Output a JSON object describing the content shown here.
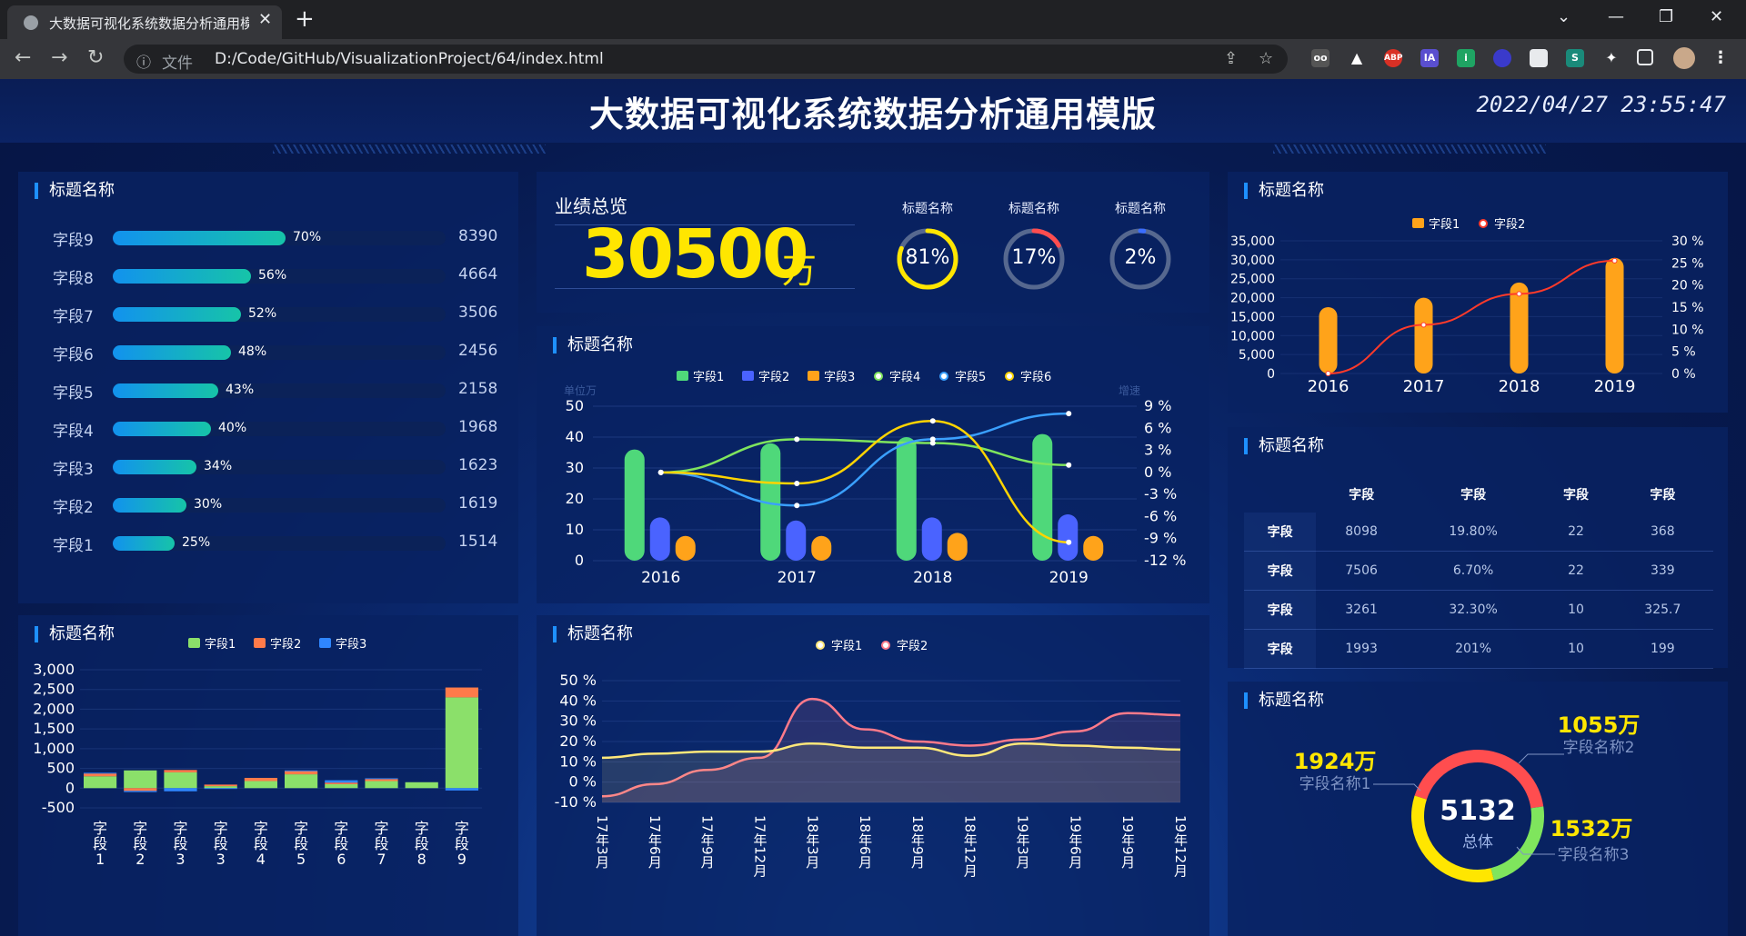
{
  "browser": {
    "tab_title": "大数据可视化系统数据分析通用模",
    "url_label": "文件",
    "url": "D:/Code/GitHub/VisualizationProject/64/index.html"
  },
  "header": {
    "title": "大数据可视化系统数据分析通用模版",
    "datetime": "2022/04/27 23:55:47"
  },
  "panel_bars": {
    "title": "标题名称",
    "items": [
      {
        "label": "字段9",
        "pct": "70%",
        "value": "8390",
        "ratio": 0.7
      },
      {
        "label": "字段8",
        "pct": "56%",
        "value": "4664",
        "ratio": 0.56
      },
      {
        "label": "字段7",
        "pct": "52%",
        "value": "3506",
        "ratio": 0.52
      },
      {
        "label": "字段6",
        "pct": "48%",
        "value": "2456",
        "ratio": 0.48
      },
      {
        "label": "字段5",
        "pct": "43%",
        "value": "2158",
        "ratio": 0.43
      },
      {
        "label": "字段4",
        "pct": "40%",
        "value": "1968",
        "ratio": 0.4
      },
      {
        "label": "字段3",
        "pct": "34%",
        "value": "1623",
        "ratio": 0.34
      },
      {
        "label": "字段2",
        "pct": "30%",
        "value": "1619",
        "ratio": 0.3
      },
      {
        "label": "字段1",
        "pct": "25%",
        "value": "1514",
        "ratio": 0.25
      }
    ]
  },
  "kpi": {
    "label": "业绩总览",
    "value": "30500",
    "unit": "万",
    "gauges": [
      {
        "title": "标题名称",
        "text": "81%",
        "ratio": 0.81,
        "color": "#ffe600"
      },
      {
        "title": "标题名称",
        "text": "17%",
        "ratio": 0.17,
        "color": "#ff4d4f"
      },
      {
        "title": "标题名称",
        "text": "2%",
        "ratio": 0.02,
        "color": "#3a6dff"
      }
    ]
  },
  "chart_mid": {
    "title": "标题名称",
    "unit_left": "单位万",
    "unit_right": "增速",
    "legend": [
      "字段1",
      "字段2",
      "字段3",
      "字段4",
      "字段5",
      "字段6"
    ],
    "x_ticks": [
      "2016",
      "2017",
      "2018",
      "2019"
    ],
    "y_left_ticks": [
      "50",
      "40",
      "30",
      "20",
      "10",
      "0"
    ],
    "y_right_ticks": [
      "9 %",
      "6 %",
      "3 %",
      "0 %",
      "-3 %",
      "-6 %",
      "-9 %",
      "-12 %"
    ]
  },
  "chart_tr": {
    "title": "标题名称",
    "legend": [
      "字段1",
      "字段2"
    ],
    "x_ticks": [
      "2016",
      "2017",
      "2018",
      "2019"
    ],
    "y_left_ticks": [
      "35,000",
      "30,000",
      "25,000",
      "20,000",
      "15,000",
      "10,000",
      "5,000",
      "0"
    ],
    "y_right_ticks": [
      "30 %",
      "25 %",
      "20 %",
      "15 %",
      "10 %",
      "5 %",
      "0 %"
    ]
  },
  "table": {
    "title": "标题名称",
    "headers": [
      "",
      "字段",
      "字段",
      "字段",
      "字段"
    ],
    "rows": [
      [
        "字段",
        "8098",
        "19.80%",
        "22",
        "368"
      ],
      [
        "字段",
        "7506",
        "6.70%",
        "22",
        "339"
      ],
      [
        "字段",
        "3261",
        "32.30%",
        "10",
        "325.7"
      ],
      [
        "字段",
        "1993",
        "201%",
        "10",
        "199"
      ]
    ]
  },
  "chart_stack": {
    "title": "标题名称",
    "legend": [
      "字段1",
      "字段2",
      "字段3"
    ],
    "y_ticks": [
      "3,000",
      "2,500",
      "2,000",
      "1,500",
      "1,000",
      "500",
      "0",
      "-500"
    ],
    "categories": [
      "字段1",
      "字段2",
      "字段3",
      "字段3",
      "字段4",
      "字段5",
      "字段6",
      "字段7",
      "字段8",
      "字段9"
    ],
    "category_labels": [
      "字\n段\n1",
      "字\n段\n2",
      "字\n段\n3",
      "字\n段\n3",
      "字\n段\n4",
      "字\n段\n5",
      "字\n段\n6",
      "字\n段\n7",
      "字\n段\n8",
      "字\n段\n9"
    ]
  },
  "chart_line": {
    "title": "标题名称",
    "legend": [
      "字段1",
      "字段2"
    ],
    "y_ticks": [
      "50 %",
      "40 %",
      "30 %",
      "20 %",
      "10 %",
      "0 %",
      "-10 %"
    ],
    "x_ticks": [
      "17年3月",
      "17年6月",
      "17年9月",
      "17年12月",
      "18年3月",
      "18年6月",
      "18年9月",
      "18年12月",
      "19年3月",
      "19年6月",
      "19年9月",
      "19年12月"
    ]
  },
  "chart_donut": {
    "title": "标题名称",
    "center_value": "5132",
    "center_label": "总体",
    "items": [
      {
        "value": "1924万",
        "label": "字段名称1",
        "color": "#ff4d4f"
      },
      {
        "value": "1055万",
        "label": "字段名称2",
        "color": "#7fe55d"
      },
      {
        "value": "1532万",
        "label": "字段名称3",
        "color": "#ffe600"
      }
    ]
  },
  "chart_data": [
    {
      "type": "bar",
      "title": "",
      "categories": [
        "字段9",
        "字段8",
        "字段7",
        "字段6",
        "字段5",
        "字段4",
        "字段3",
        "字段2",
        "字段1"
      ],
      "values": [
        8390,
        4664,
        3506,
        2456,
        2158,
        1968,
        1623,
        1619,
        1514
      ],
      "percent": [
        70,
        56,
        52,
        48,
        43,
        40,
        34,
        30,
        25
      ]
    },
    {
      "type": "bar",
      "categories": [
        "2016",
        "2017",
        "2018",
        "2019"
      ],
      "ylabel": "单位万",
      "y2label": "增速",
      "ylim": [
        0,
        50
      ],
      "y2lim": [
        -12,
        9
      ],
      "series": [
        {
          "name": "字段1",
          "kind": "bar",
          "values": [
            36,
            38,
            40,
            41
          ],
          "color": "#4fd87a"
        },
        {
          "name": "字段2",
          "kind": "bar",
          "values": [
            14,
            13,
            14,
            15
          ],
          "color": "#4a63ff"
        },
        {
          "name": "字段3",
          "kind": "bar",
          "values": [
            8,
            8,
            9,
            8
          ],
          "color": "#ffa31a"
        },
        {
          "name": "字段4",
          "kind": "line",
          "axis": "right",
          "values": [
            0,
            4.5,
            4,
            1
          ],
          "color": "#7fe55d"
        },
        {
          "name": "字段5",
          "kind": "line",
          "axis": "right",
          "values": [
            0,
            -4.5,
            4.5,
            8
          ],
          "color": "#3aa0ff"
        },
        {
          "name": "字段6",
          "kind": "line",
          "axis": "right",
          "values": [
            0,
            -1.5,
            7,
            -9.5
          ],
          "color": "#ffd400"
        }
      ]
    },
    {
      "type": "bar",
      "categories": [
        "2016",
        "2017",
        "2018",
        "2019"
      ],
      "ylim": [
        0,
        35000
      ],
      "y2lim": [
        0,
        30
      ],
      "series": [
        {
          "name": "字段1",
          "kind": "bar",
          "values": [
            17500,
            20000,
            24000,
            30500
          ],
          "color": "#ffa31a"
        },
        {
          "name": "字段2",
          "kind": "line",
          "axis": "right",
          "values": [
            0,
            11,
            18,
            25.5
          ],
          "color": "#ff3a2a"
        }
      ]
    },
    {
      "type": "bar",
      "stacked": true,
      "categories": [
        "字段1",
        "字段2",
        "字段3",
        "字段3",
        "字段4",
        "字段5",
        "字段6",
        "字段7",
        "字段8",
        "字段9"
      ],
      "ylim": [
        -500,
        3000
      ],
      "series": [
        {
          "name": "字段1",
          "values": [
            300,
            450,
            400,
            50,
            180,
            350,
            100,
            180,
            150,
            2300
          ],
          "color": "#8be06a"
        },
        {
          "name": "字段2",
          "values": [
            70,
            -70,
            60,
            40,
            80,
            80,
            40,
            50,
            0,
            250
          ],
          "color": "#ff7b4a"
        },
        {
          "name": "字段3",
          "values": [
            20,
            -30,
            -80,
            -20,
            0,
            20,
            60,
            20,
            0,
            -60
          ],
          "color": "#2f86ff"
        }
      ]
    },
    {
      "type": "area",
      "x": [
        "17年3月",
        "17年6月",
        "17年9月",
        "17年12月",
        "18年3月",
        "18年6月",
        "18年9月",
        "18年12月",
        "19年3月",
        "19年6月",
        "19年9月",
        "19年12月"
      ],
      "ylim": [
        -10,
        50
      ],
      "series": [
        {
          "name": "字段1",
          "values": [
            12,
            14,
            15,
            15,
            19,
            17,
            17,
            13,
            19,
            18,
            17,
            16
          ],
          "color": "#ffe87a"
        },
        {
          "name": "字段2",
          "values": [
            -7,
            -1,
            6,
            12,
            41,
            26,
            20,
            18,
            21,
            25,
            34,
            33
          ],
          "color": "#ff7a8a"
        }
      ]
    },
    {
      "type": "pie",
      "title": "",
      "categories": [
        "字段名称1",
        "字段名称2",
        "字段名称3"
      ],
      "values": [
        1924,
        1055,
        1532
      ],
      "total": 5132
    }
  ]
}
